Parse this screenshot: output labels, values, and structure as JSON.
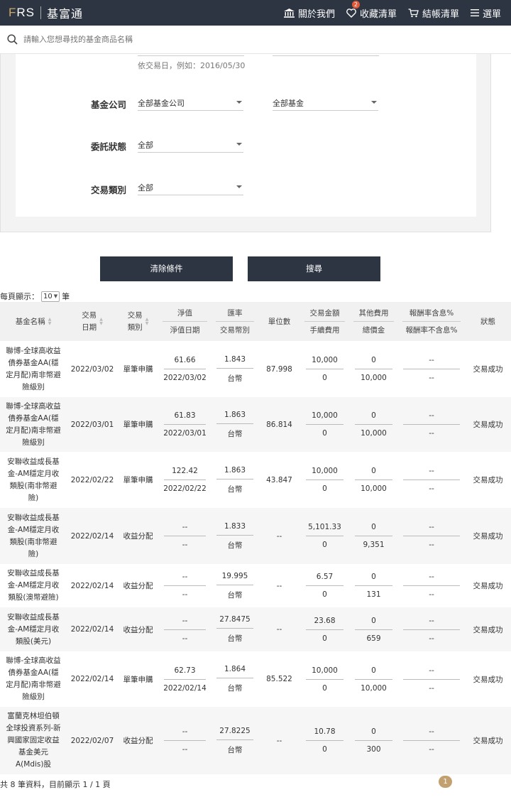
{
  "nav": {
    "logo_text": "FRS",
    "brand_name": "基富通",
    "items": [
      {
        "label": "關於我們",
        "icon": "bank-icon"
      },
      {
        "label": "收藏清單",
        "icon": "heart-icon",
        "badge": "2"
      },
      {
        "label": "結帳清單",
        "icon": "cart-icon"
      },
      {
        "label": "選單",
        "icon": "menu-icon"
      }
    ]
  },
  "search": {
    "placeholder": "請輸入您想尋找的基金商品名稱"
  },
  "filters": {
    "date_hint": "依交易日，例如：2016/05/30",
    "fund_company_label": "基金公司",
    "fund_company_value": "全部基金公司",
    "fund_value": "全部基金",
    "status_label": "委託狀態",
    "status_value": "全部",
    "type_label": "交易類別",
    "type_value": "全部"
  },
  "buttons": {
    "clear": "清除條件",
    "search": "搜尋"
  },
  "pagesize": {
    "prefix": "每頁顯示：",
    "value": "10",
    "suffix": "筆"
  },
  "table": {
    "headers": {
      "fund_name": "基金名稱",
      "trade_date_1": "交易",
      "trade_date_2": "日期",
      "trade_type_1": "交易",
      "trade_type_2": "類別",
      "nav_top": "淨值",
      "nav_bottom": "淨值日期",
      "fx_top": "匯率",
      "fx_bottom": "交易幣別",
      "units": "單位數",
      "amount_top": "交易金額",
      "amount_bottom": "手續費用",
      "other_top": "其他費用",
      "other_bottom": "總價金",
      "return_top": "報酬率含息%",
      "return_bottom": "報酬率不含息%",
      "status": "狀態"
    },
    "rows": [
      {
        "name": "聯博-全球高收益債券基金AA(穩定月配)南非幣避險級別",
        "date": "2022/03/02",
        "type": "單筆申購",
        "nav": "61.66",
        "nav_date": "2022/03/02",
        "fx": "1.843",
        "currency": "台幣",
        "units": "87.998",
        "amount": "10,000",
        "fee": "0",
        "other": "0",
        "total": "10,000",
        "ret_in": "--",
        "ret_ex": "--",
        "status": "交易成功"
      },
      {
        "name": "聯博-全球高收益債券基金AA(穩定月配)南非幣避險級別",
        "date": "2022/03/01",
        "type": "單筆申購",
        "nav": "61.83",
        "nav_date": "2022/03/01",
        "fx": "1.863",
        "currency": "台幣",
        "units": "86.814",
        "amount": "10,000",
        "fee": "0",
        "other": "0",
        "total": "10,000",
        "ret_in": "--",
        "ret_ex": "--",
        "status": "交易成功"
      },
      {
        "name": "安聯收益成長基金-AM穩定月收類股(南非幣避險)",
        "date": "2022/02/22",
        "type": "單筆申購",
        "nav": "122.42",
        "nav_date": "2022/02/22",
        "fx": "1.863",
        "currency": "台幣",
        "units": "43.847",
        "amount": "10,000",
        "fee": "0",
        "other": "0",
        "total": "10,000",
        "ret_in": "--",
        "ret_ex": "--",
        "status": "交易成功"
      },
      {
        "name": "安聯收益成長基金-AM穩定月收類股(南非幣避險)",
        "date": "2022/02/14",
        "type": "收益分配",
        "nav": "--",
        "nav_date": "--",
        "fx": "1.833",
        "currency": "台幣",
        "units": "--",
        "amount": "5,101.33",
        "fee": "0",
        "other": "0",
        "total": "9,351",
        "ret_in": "--",
        "ret_ex": "--",
        "status": "交易成功"
      },
      {
        "name": "安聯收益成長基金-AM穩定月收類股(澳幣避險)",
        "date": "2022/02/14",
        "type": "收益分配",
        "nav": "--",
        "nav_date": "--",
        "fx": "19.995",
        "currency": "台幣",
        "units": "--",
        "amount": "6.57",
        "fee": "0",
        "other": "0",
        "total": "131",
        "ret_in": "--",
        "ret_ex": "--",
        "status": "交易成功"
      },
      {
        "name": "安聯收益成長基金-AM穩定月收類股(美元)",
        "date": "2022/02/14",
        "type": "收益分配",
        "nav": "--",
        "nav_date": "--",
        "fx": "27.8475",
        "currency": "台幣",
        "units": "--",
        "amount": "23.68",
        "fee": "0",
        "other": "0",
        "total": "659",
        "ret_in": "--",
        "ret_ex": "--",
        "status": "交易成功"
      },
      {
        "name": "聯博-全球高收益債券基金AA(穩定月配)南非幣避險級別",
        "date": "2022/02/14",
        "type": "單筆申購",
        "nav": "62.73",
        "nav_date": "2022/02/14",
        "fx": "1.864",
        "currency": "台幣",
        "units": "85.522",
        "amount": "10,000",
        "fee": "0",
        "other": "0",
        "total": "10,000",
        "ret_in": "--",
        "ret_ex": "--",
        "status": "交易成功"
      },
      {
        "name": "富蘭克林坦伯頓全球投資系列-新興國家固定收益基金美元A(Mdis)股",
        "date": "2022/02/07",
        "type": "收益分配",
        "nav": "--",
        "nav_date": "--",
        "fx": "27.8225",
        "currency": "台幣",
        "units": "--",
        "amount": "10.78",
        "fee": "0",
        "other": "0",
        "total": "300",
        "ret_in": "--",
        "ret_ex": "--",
        "status": "交易成功"
      }
    ]
  },
  "footer": {
    "info": "共 8 筆資料，目前顯示 1 / 1 頁",
    "page": "1"
  }
}
